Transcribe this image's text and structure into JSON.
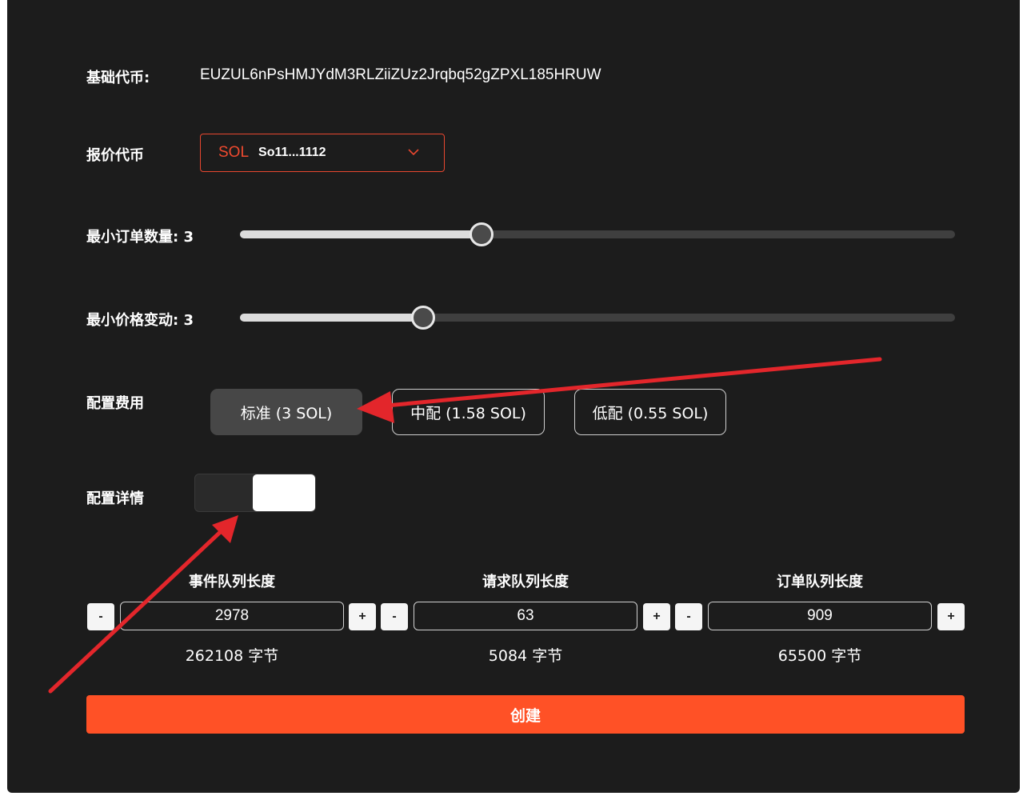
{
  "base_token": {
    "label": "基础代币:",
    "address": "EUZUL6nPsHMJYdM3RLZiiZUz2Jrqbq52gZPXL185HRUW"
  },
  "quote_token": {
    "label": "报价代币",
    "symbol": "SOL",
    "address_short": "So11...1112",
    "icon": "chevron-down-icon"
  },
  "min_order": {
    "label": "最小订单数量: 3",
    "value": 3,
    "fill_fraction": 0.338
  },
  "min_price": {
    "label": "最小价格变动: 3",
    "value": 3,
    "fill_fraction": 0.256
  },
  "fee_config": {
    "label": "配置费用",
    "options": [
      {
        "label": "标准 (3 SOL)",
        "selected": true
      },
      {
        "label": "中配 (1.58 SOL)",
        "selected": false
      },
      {
        "label": "低配 (0.55 SOL)",
        "selected": false
      }
    ]
  },
  "details": {
    "label": "配置详情",
    "enabled": true
  },
  "queues": [
    {
      "title": "事件队列长度",
      "value": "2978",
      "bytes": "262108 字节"
    },
    {
      "title": "请求队列长度",
      "value": "63",
      "bytes": "5084 字节"
    },
    {
      "title": "订单队列长度",
      "value": "909",
      "bytes": "65500 字节"
    }
  ],
  "stepper": {
    "minus": "-",
    "plus": "+"
  },
  "create_button": "创建",
  "colors": {
    "accent": "#ff5126",
    "background": "#1c1c1c",
    "annotation_arrow": "#e3262b"
  }
}
